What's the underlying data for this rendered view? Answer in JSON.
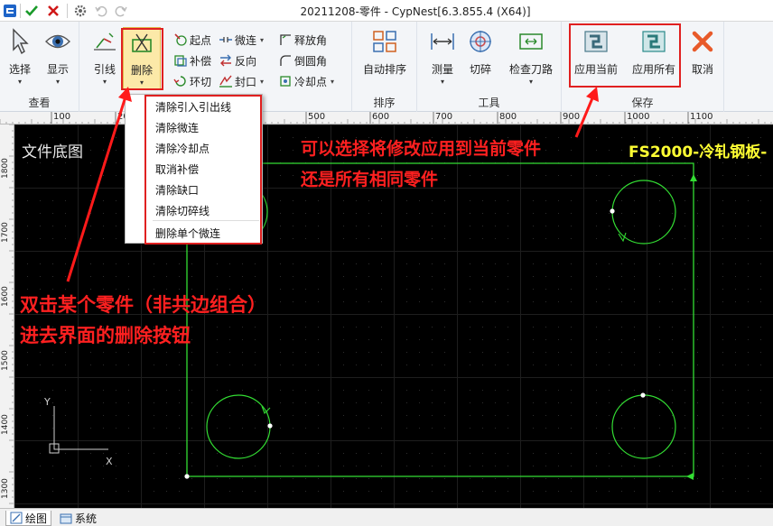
{
  "titlebar": {
    "title": "20211208-零件 - CypNest[6.3.855.4 (X64)]",
    "icons": [
      "app-logo-icon",
      "check-icon",
      "close-x-icon",
      "gear-icon",
      "undo-icon",
      "redo-icon"
    ]
  },
  "ribbon": {
    "groups": [
      {
        "label": "查看"
      },
      {
        "label": ""
      },
      {
        "label": "排序"
      },
      {
        "label": "工具"
      },
      {
        "label": "保存"
      }
    ],
    "view": {
      "select": "选择",
      "display": "显示"
    },
    "lead": {
      "lead": "引线",
      "delete": "删除"
    },
    "small": {
      "start_point": "起点",
      "micro_joint": "微连",
      "release_angle": "释放角",
      "compensation": "补偿",
      "reverse": "反向",
      "fillet": "倒圆角",
      "loop_cut": "环切",
      "seal": "封口",
      "cooling_point": "冷却点"
    },
    "sort": {
      "auto_sort": "自动排序"
    },
    "tools": {
      "measure": "测量",
      "cut_break": "切碎",
      "check_path": "检查刀路"
    },
    "save": {
      "apply_current": "应用当前",
      "apply_all": "应用所有"
    },
    "cancel": "取消"
  },
  "dropdown": {
    "items": [
      "清除引入引出线",
      "清除微连",
      "清除冷却点",
      "取消补偿",
      "清除缺口",
      "清除切碎线",
      "删除单个微连"
    ]
  },
  "ruler": {
    "top_labels": [
      "100",
      "200",
      "300",
      "400",
      "500",
      "600",
      "700",
      "800",
      "900",
      "1000",
      "1100"
    ],
    "left_labels": [
      "1800",
      "1700",
      "1600",
      "1500",
      "1400",
      "1300"
    ]
  },
  "canvas": {
    "doc_label": "文件底图",
    "material": "FS2000-冷轧钢板-",
    "axis_y": "Y",
    "axis_x": "X"
  },
  "annotations": {
    "top_line1": "可以选择将修改应用到当前零件",
    "top_line2": "还是所有相同零件",
    "left_line1": "双击某个零件（非共边组合）",
    "left_line2": "进去界面的删除按钮"
  },
  "bottom_tabs": {
    "drawing": "绘图",
    "system": "系统"
  },
  "colors": {
    "part_outline": "#33dd33",
    "annotation_red": "#ff2020",
    "material_yellow": "#ffff33",
    "canvas_bg": "#000000"
  }
}
